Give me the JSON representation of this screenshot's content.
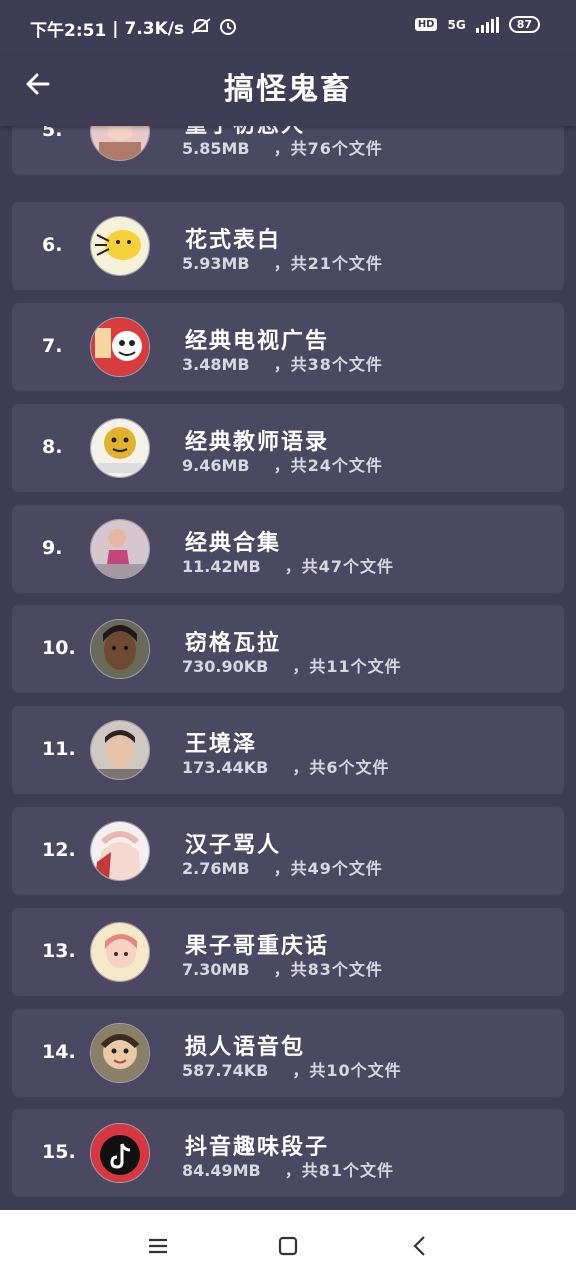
{
  "status": {
    "time": "下午2:51",
    "speed": "7.3K/s",
    "network": "5G",
    "battery": "87",
    "hd": "HD"
  },
  "header": {
    "title": "搞怪鬼畜"
  },
  "items": [
    {
      "rank": "5.",
      "name": "童子初恋人",
      "size": "5.85MB",
      "count": "，共76个文件",
      "avatar": {
        "bg": "#e8c8c8",
        "face": "#f2d3c2"
      }
    },
    {
      "rank": "6.",
      "name": "花式表白",
      "size": "5.93MB",
      "count": "，共21个文件",
      "avatar": {
        "bg": "#f5f0d8",
        "face": "#f7d13a"
      }
    },
    {
      "rank": "7.",
      "name": "经典电视广告",
      "size": "3.48MB",
      "count": "，共38个文件",
      "avatar": {
        "bg": "#d93c3c",
        "face": "#ffffff"
      }
    },
    {
      "rank": "8.",
      "name": "经典教师语录",
      "size": "9.46MB",
      "count": "，共24个文件",
      "avatar": {
        "bg": "#f3f1e8",
        "face": "#e2b12e"
      }
    },
    {
      "rank": "9.",
      "name": "经典合集",
      "size": "11.42MB",
      "count": "，共47个文件",
      "avatar": {
        "bg": "#d6c7cf",
        "face": "#c2477a"
      }
    },
    {
      "rank": "10.",
      "name": "窃格瓦拉",
      "size": "730.90KB",
      "count": "，共11个文件",
      "avatar": {
        "bg": "#6b6a58",
        "face": "#6e4a34"
      }
    },
    {
      "rank": "11.",
      "name": "王境泽",
      "size": "173.44KB",
      "count": "，共6个文件",
      "avatar": {
        "bg": "#cfc8c2",
        "face": "#e4c1a8"
      }
    },
    {
      "rank": "12.",
      "name": "汉子骂人",
      "size": "2.76MB",
      "count": "，共49个文件",
      "avatar": {
        "bg": "#f4efef",
        "face": "#c23a3a"
      }
    },
    {
      "rank": "13.",
      "name": "果子哥重庆话",
      "size": "7.30MB",
      "count": "，共83个文件",
      "avatar": {
        "bg": "#f5e9c9",
        "face": "#e8847a"
      }
    },
    {
      "rank": "14.",
      "name": "损人语音包",
      "size": "587.74KB",
      "count": "，共10个文件",
      "avatar": {
        "bg": "#8a8068",
        "face": "#e9c9a8"
      }
    },
    {
      "rank": "15.",
      "name": "抖音趣味段子",
      "size": "84.49MB",
      "count": "，共81个文件",
      "avatar": {
        "bg": "#d8373f",
        "face": "#111111"
      }
    }
  ]
}
